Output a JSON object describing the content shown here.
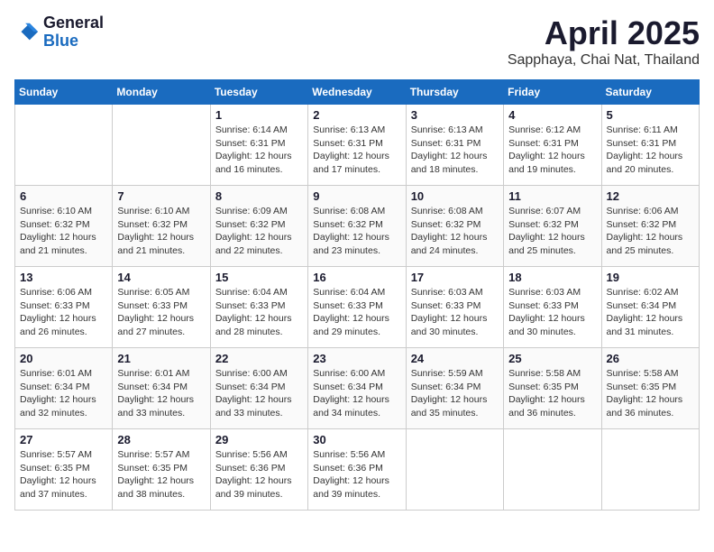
{
  "logo": {
    "general": "General",
    "blue": "Blue"
  },
  "title": {
    "month": "April 2025",
    "location": "Sapphaya, Chai Nat, Thailand"
  },
  "calendar": {
    "headers": [
      "Sunday",
      "Monday",
      "Tuesday",
      "Wednesday",
      "Thursday",
      "Friday",
      "Saturday"
    ],
    "weeks": [
      [
        {
          "day": "",
          "info": ""
        },
        {
          "day": "",
          "info": ""
        },
        {
          "day": "1",
          "info": "Sunrise: 6:14 AM\nSunset: 6:31 PM\nDaylight: 12 hours and 16 minutes."
        },
        {
          "day": "2",
          "info": "Sunrise: 6:13 AM\nSunset: 6:31 PM\nDaylight: 12 hours and 17 minutes."
        },
        {
          "day": "3",
          "info": "Sunrise: 6:13 AM\nSunset: 6:31 PM\nDaylight: 12 hours and 18 minutes."
        },
        {
          "day": "4",
          "info": "Sunrise: 6:12 AM\nSunset: 6:31 PM\nDaylight: 12 hours and 19 minutes."
        },
        {
          "day": "5",
          "info": "Sunrise: 6:11 AM\nSunset: 6:31 PM\nDaylight: 12 hours and 20 minutes."
        }
      ],
      [
        {
          "day": "6",
          "info": "Sunrise: 6:10 AM\nSunset: 6:32 PM\nDaylight: 12 hours and 21 minutes."
        },
        {
          "day": "7",
          "info": "Sunrise: 6:10 AM\nSunset: 6:32 PM\nDaylight: 12 hours and 21 minutes."
        },
        {
          "day": "8",
          "info": "Sunrise: 6:09 AM\nSunset: 6:32 PM\nDaylight: 12 hours and 22 minutes."
        },
        {
          "day": "9",
          "info": "Sunrise: 6:08 AM\nSunset: 6:32 PM\nDaylight: 12 hours and 23 minutes."
        },
        {
          "day": "10",
          "info": "Sunrise: 6:08 AM\nSunset: 6:32 PM\nDaylight: 12 hours and 24 minutes."
        },
        {
          "day": "11",
          "info": "Sunrise: 6:07 AM\nSunset: 6:32 PM\nDaylight: 12 hours and 25 minutes."
        },
        {
          "day": "12",
          "info": "Sunrise: 6:06 AM\nSunset: 6:32 PM\nDaylight: 12 hours and 25 minutes."
        }
      ],
      [
        {
          "day": "13",
          "info": "Sunrise: 6:06 AM\nSunset: 6:33 PM\nDaylight: 12 hours and 26 minutes."
        },
        {
          "day": "14",
          "info": "Sunrise: 6:05 AM\nSunset: 6:33 PM\nDaylight: 12 hours and 27 minutes."
        },
        {
          "day": "15",
          "info": "Sunrise: 6:04 AM\nSunset: 6:33 PM\nDaylight: 12 hours and 28 minutes."
        },
        {
          "day": "16",
          "info": "Sunrise: 6:04 AM\nSunset: 6:33 PM\nDaylight: 12 hours and 29 minutes."
        },
        {
          "day": "17",
          "info": "Sunrise: 6:03 AM\nSunset: 6:33 PM\nDaylight: 12 hours and 30 minutes."
        },
        {
          "day": "18",
          "info": "Sunrise: 6:03 AM\nSunset: 6:33 PM\nDaylight: 12 hours and 30 minutes."
        },
        {
          "day": "19",
          "info": "Sunrise: 6:02 AM\nSunset: 6:34 PM\nDaylight: 12 hours and 31 minutes."
        }
      ],
      [
        {
          "day": "20",
          "info": "Sunrise: 6:01 AM\nSunset: 6:34 PM\nDaylight: 12 hours and 32 minutes."
        },
        {
          "day": "21",
          "info": "Sunrise: 6:01 AM\nSunset: 6:34 PM\nDaylight: 12 hours and 33 minutes."
        },
        {
          "day": "22",
          "info": "Sunrise: 6:00 AM\nSunset: 6:34 PM\nDaylight: 12 hours and 33 minutes."
        },
        {
          "day": "23",
          "info": "Sunrise: 6:00 AM\nSunset: 6:34 PM\nDaylight: 12 hours and 34 minutes."
        },
        {
          "day": "24",
          "info": "Sunrise: 5:59 AM\nSunset: 6:34 PM\nDaylight: 12 hours and 35 minutes."
        },
        {
          "day": "25",
          "info": "Sunrise: 5:58 AM\nSunset: 6:35 PM\nDaylight: 12 hours and 36 minutes."
        },
        {
          "day": "26",
          "info": "Sunrise: 5:58 AM\nSunset: 6:35 PM\nDaylight: 12 hours and 36 minutes."
        }
      ],
      [
        {
          "day": "27",
          "info": "Sunrise: 5:57 AM\nSunset: 6:35 PM\nDaylight: 12 hours and 37 minutes."
        },
        {
          "day": "28",
          "info": "Sunrise: 5:57 AM\nSunset: 6:35 PM\nDaylight: 12 hours and 38 minutes."
        },
        {
          "day": "29",
          "info": "Sunrise: 5:56 AM\nSunset: 6:36 PM\nDaylight: 12 hours and 39 minutes."
        },
        {
          "day": "30",
          "info": "Sunrise: 5:56 AM\nSunset: 6:36 PM\nDaylight: 12 hours and 39 minutes."
        },
        {
          "day": "",
          "info": ""
        },
        {
          "day": "",
          "info": ""
        },
        {
          "day": "",
          "info": ""
        }
      ]
    ]
  }
}
